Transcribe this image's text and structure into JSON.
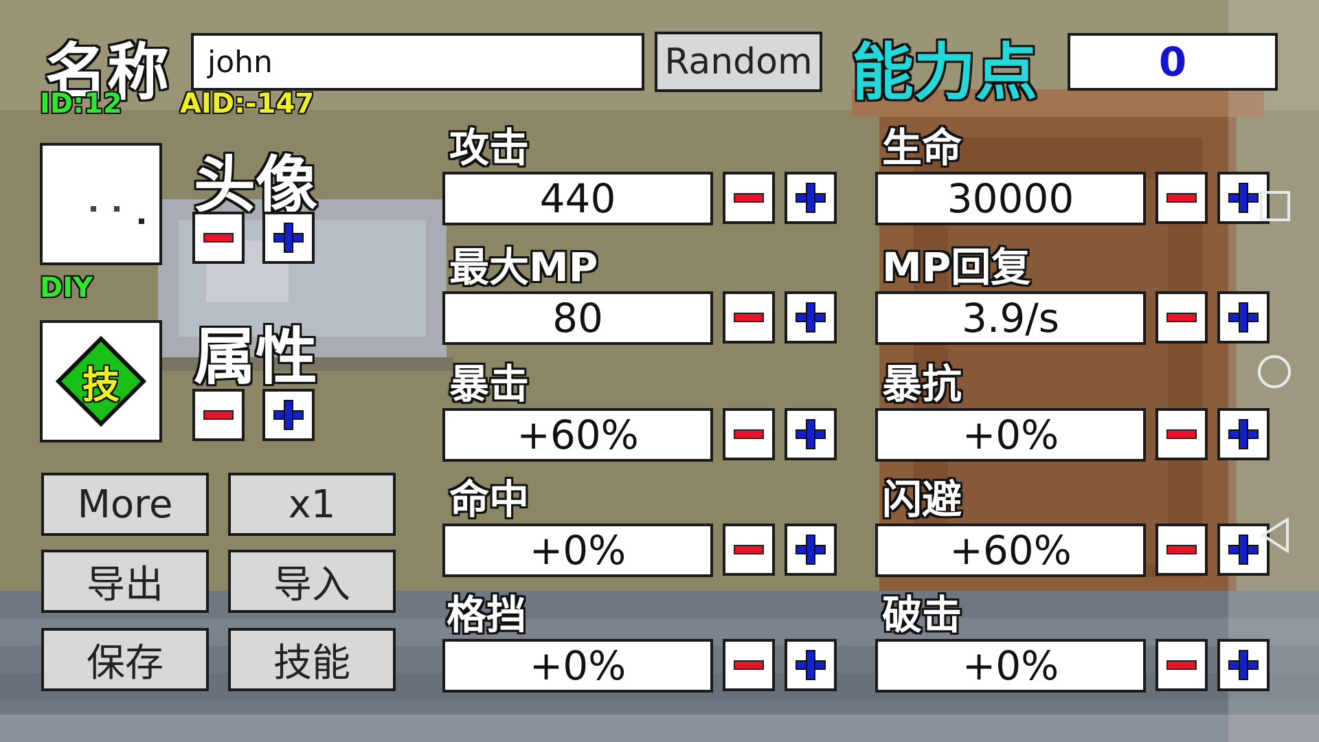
{
  "header": {
    "name_label": "名称",
    "name_value": "john",
    "random_label": "Random",
    "points_label": "能力点",
    "points_value": "0",
    "id_text": "ID:12",
    "aid_text": "AID:-147"
  },
  "avatar": {
    "label": "头像",
    "diy_text": "DIY"
  },
  "attribute": {
    "label": "属性",
    "badge_text": "技"
  },
  "buttons": {
    "more": "More",
    "multiplier": "x1",
    "export": "导出",
    "import": "导入",
    "save": "保存",
    "skills": "技能"
  },
  "stats_left": [
    {
      "label": "攻击",
      "value": "440"
    },
    {
      "label": "最大MP",
      "value": "80"
    },
    {
      "label": "暴击",
      "value": "+60%"
    },
    {
      "label": "命中",
      "value": "+0%"
    },
    {
      "label": "格挡",
      "value": "+0%"
    }
  ],
  "stats_right": [
    {
      "label": "生命",
      "value": "30000"
    },
    {
      "label": "MP回复",
      "value": "3.9/s"
    },
    {
      "label": "暴抗",
      "value": "+0%"
    },
    {
      "label": "闪避",
      "value": "+60%"
    },
    {
      "label": "破击",
      "value": "+0%"
    }
  ],
  "colors": {
    "points_label": "#22d8d8",
    "points_value": "#1414d0",
    "id_text": "#2ee82e",
    "aid_text": "#f0f020",
    "diy_text": "#2ee82e",
    "minus": "#e8142a",
    "plus": "#1420c8"
  },
  "icons": {
    "minus": "minus-icon",
    "plus": "plus-icon",
    "skill_badge": "skill-diamond-icon",
    "nav_square": "recent-apps-icon",
    "nav_circle": "home-icon",
    "nav_triangle": "back-icon"
  }
}
